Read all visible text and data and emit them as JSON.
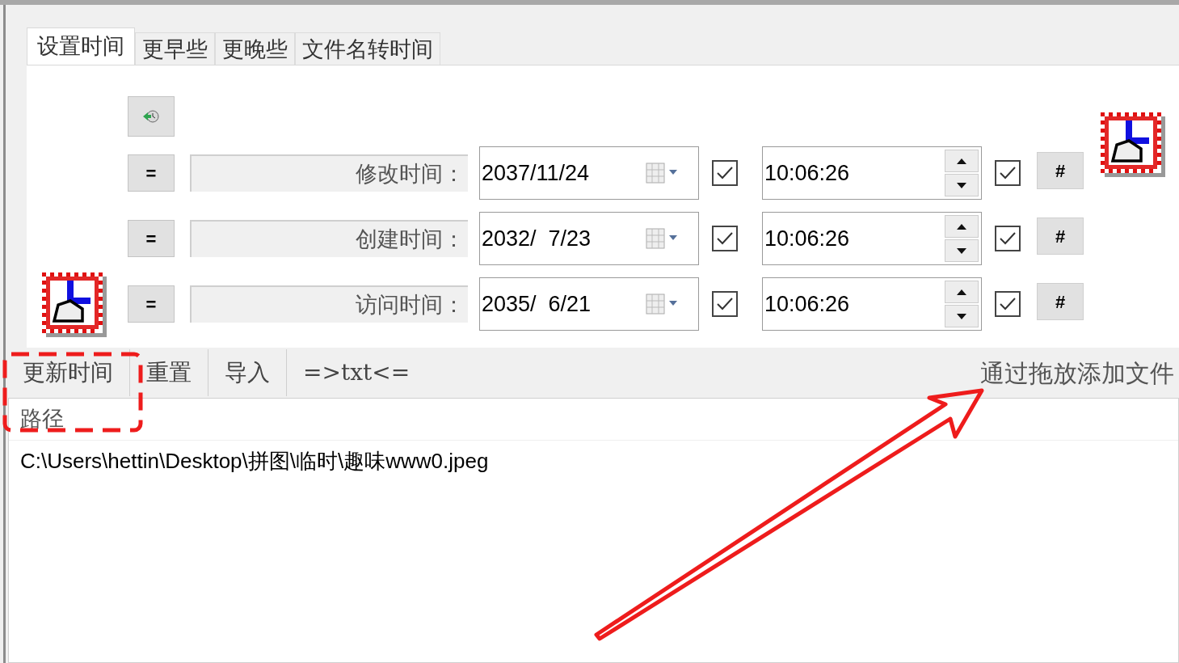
{
  "tabs": [
    {
      "label": "设置时间",
      "selected": true
    },
    {
      "label": "更早些",
      "selected": false
    },
    {
      "label": "更晚些",
      "selected": false
    },
    {
      "label": "文件名转时间",
      "selected": false
    }
  ],
  "equals_label": "=",
  "rows": [
    {
      "label": "修改时间：",
      "date": "2037/11/24",
      "date_checked": true,
      "time": "10:06:26",
      "time_checked": true,
      "hash_label": "#"
    },
    {
      "label": "创建时间：",
      "date": "2032/  7/23",
      "date_checked": true,
      "time": "10:06:26",
      "time_checked": true,
      "hash_label": "#"
    },
    {
      "label": "访问时间：",
      "date": "2035/  6/21",
      "date_checked": true,
      "time": "10:06:26",
      "time_checked": true,
      "hash_label": "#"
    }
  ],
  "toolbar": {
    "buttons": [
      "更新时间",
      "重置",
      "导入",
      "=>txt<="
    ],
    "drop_hint": "通过拖放添加文件"
  },
  "file_list": {
    "column": "路径",
    "rows": [
      "C:\\Users\\hettin\\Desktop\\拼图\\临时\\趣味www0.jpeg"
    ]
  }
}
